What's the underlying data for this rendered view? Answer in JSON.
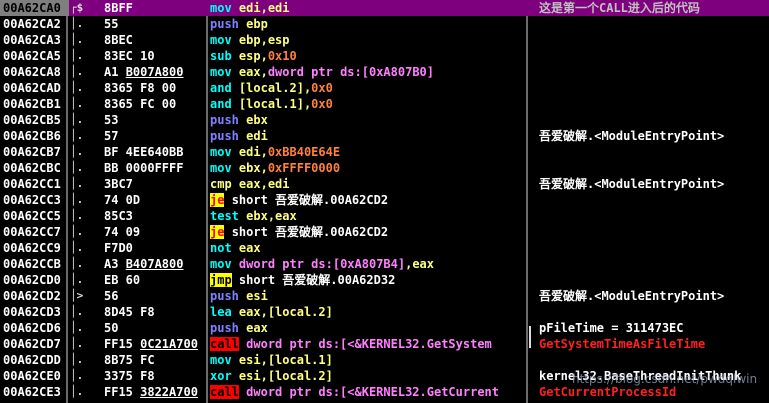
{
  "comment_banner": "这是第一个CALL进入后的代码",
  "watermark": "https://blog.csdn.net/pwdqlwin",
  "rows": [
    {
      "addr": "00A62CA0",
      "gut": "┌$",
      "hex": "8BFF",
      "mn": "mov",
      "mc": "plain",
      "args": [
        {
          "t": "edi,edi",
          "c": "reg"
        }
      ],
      "cmt": [
        {
          "t": "这是第一个CALL进入后的代码",
          "c": "gray"
        }
      ],
      "sel": true
    },
    {
      "addr": "00A62CA2",
      "gut": "│.",
      "hex": "55",
      "mn": "push",
      "mc": "push",
      "args": [
        {
          "t": "ebp",
          "c": "reg"
        }
      ],
      "cmt": []
    },
    {
      "addr": "00A62CA3",
      "gut": "│.",
      "hex": "8BEC",
      "mn": "mov",
      "mc": "plain",
      "args": [
        {
          "t": "ebp,esp",
          "c": "reg"
        }
      ],
      "cmt": []
    },
    {
      "addr": "00A62CA5",
      "gut": "│.",
      "hex": "83EC 10",
      "mn": "sub",
      "mc": "plain",
      "args": [
        {
          "t": "esp,",
          "c": "reg"
        },
        {
          "t": "0x10",
          "c": "num"
        }
      ],
      "cmt": []
    },
    {
      "addr": "00A62CA8",
      "gut": "│.",
      "hex": "A1 ",
      "hexu": "B007A800",
      "mn": "mov",
      "mc": "plain",
      "args": [
        {
          "t": "eax,",
          "c": "reg"
        },
        {
          "t": "dword ptr ds:[0xA807B0]",
          "c": "mem"
        }
      ],
      "cmt": []
    },
    {
      "addr": "00A62CAD",
      "gut": "│.",
      "hex": "8365 F8 00",
      "mn": "and",
      "mc": "plain",
      "args": [
        {
          "t": "[local.2],",
          "c": "reg"
        },
        {
          "t": "0x0",
          "c": "num"
        }
      ],
      "cmt": []
    },
    {
      "addr": "00A62CB1",
      "gut": "│.",
      "hex": "8365 FC 00",
      "mn": "and",
      "mc": "plain",
      "args": [
        {
          "t": "[local.1],",
          "c": "reg"
        },
        {
          "t": "0x0",
          "c": "num"
        }
      ],
      "cmt": []
    },
    {
      "addr": "00A62CB5",
      "gut": "│.",
      "hex": "53",
      "mn": "push",
      "mc": "push",
      "args": [
        {
          "t": "ebx",
          "c": "reg"
        }
      ],
      "cmt": []
    },
    {
      "addr": "00A62CB6",
      "gut": "│.",
      "hex": "57",
      "mn": "push",
      "mc": "push",
      "args": [
        {
          "t": "edi",
          "c": "reg"
        }
      ],
      "cmt": [
        {
          "t": "吾爱破解.<ModuleEntryPoint>",
          "c": "w"
        }
      ]
    },
    {
      "addr": "00A62CB7",
      "gut": "│.",
      "hex": "BF 4EE640BB",
      "mn": "mov",
      "mc": "plain",
      "args": [
        {
          "t": "edi,",
          "c": "reg"
        },
        {
          "t": "0xBB40E64E",
          "c": "num"
        }
      ],
      "cmt": []
    },
    {
      "addr": "00A62CBC",
      "gut": "│.",
      "hex": "BB 0000FFFF",
      "mn": "mov",
      "mc": "plain",
      "args": [
        {
          "t": "ebx,",
          "c": "reg"
        },
        {
          "t": "0xFFFF0000",
          "c": "num"
        }
      ],
      "cmt": []
    },
    {
      "addr": "00A62CC1",
      "gut": "│.",
      "hex": "3BC7",
      "mn": "cmp",
      "mc": "cmp",
      "args": [
        {
          "t": "eax,edi",
          "c": "reg"
        }
      ],
      "cmt": [
        {
          "t": "吾爱破解.<ModuleEntryPoint>",
          "c": "w"
        }
      ]
    },
    {
      "addr": "00A62CC3",
      "gut": "│.",
      "hex": "74 0D",
      "mn": "je",
      "mc": "je",
      "args": [
        {
          "t": "short 吾爱破解.00A62CD2",
          "c": "txt"
        }
      ],
      "cmt": []
    },
    {
      "addr": "00A62CC5",
      "gut": "│.",
      "hex": "85C3",
      "mn": "test",
      "mc": "plain",
      "args": [
        {
          "t": "ebx,eax",
          "c": "reg"
        }
      ],
      "cmt": []
    },
    {
      "addr": "00A62CC7",
      "gut": "│.",
      "hex": "74 09",
      "mn": "je",
      "mc": "je",
      "args": [
        {
          "t": "short 吾爱破解.00A62CD2",
          "c": "txt"
        }
      ],
      "cmt": []
    },
    {
      "addr": "00A62CC9",
      "gut": "│.",
      "hex": "F7D0",
      "mn": "not",
      "mc": "plain",
      "args": [
        {
          "t": "eax",
          "c": "reg"
        }
      ],
      "cmt": []
    },
    {
      "addr": "00A62CCB",
      "gut": "│.",
      "hex": "A3 ",
      "hexu": "B407A800",
      "mn": "mov",
      "mc": "plain",
      "args": [
        {
          "t": "dword ptr ds:[0xA807B4]",
          "c": "mem"
        },
        {
          "t": ",eax",
          "c": "reg"
        }
      ],
      "cmt": []
    },
    {
      "addr": "00A62CD0",
      "gut": "│.",
      "hex": "EB 60",
      "mn": "jmp",
      "mc": "jmp",
      "args": [
        {
          "t": "short 吾爱破解.00A62D32",
          "c": "txt"
        }
      ],
      "cmt": []
    },
    {
      "addr": "00A62CD2",
      "gut": "│>",
      "hex": "56",
      "mn": "push",
      "mc": "push",
      "args": [
        {
          "t": "esi",
          "c": "reg"
        }
      ],
      "cmt": [
        {
          "t": "吾爱破解.<ModuleEntryPoint>",
          "c": "w"
        }
      ]
    },
    {
      "addr": "00A62CD3",
      "gut": "│.",
      "hex": "8D45 F8",
      "mn": "lea",
      "mc": "plain",
      "args": [
        {
          "t": "eax,[local.2]",
          "c": "reg"
        }
      ],
      "cmt": []
    },
    {
      "addr": "00A62CD6",
      "gut": "│.",
      "hex": "50",
      "mn": "push",
      "mc": "push",
      "args": [
        {
          "t": "eax",
          "c": "reg"
        }
      ],
      "cmt": [
        {
          "t": "pFileTime = 311473EC",
          "c": "w"
        }
      ]
    },
    {
      "addr": "00A62CD7",
      "gut": "│.",
      "hex": "FF15 ",
      "hexu": "0C21A700",
      "mn": "call",
      "mc": "call",
      "args": [
        {
          "t": "dword ptr ds:[<&KERNEL32.GetSystem",
          "c": "sym"
        }
      ],
      "cmt": [
        {
          "t": "GetSystemTimeAsFileTime",
          "c": "red"
        }
      ]
    },
    {
      "addr": "00A62CDD",
      "gut": "│.",
      "hex": "8B75 FC",
      "mn": "mov",
      "mc": "plain",
      "args": [
        {
          "t": "esi,[local.1]",
          "c": "reg"
        }
      ],
      "cmt": []
    },
    {
      "addr": "00A62CE0",
      "gut": "│.",
      "hex": "3375 F8",
      "mn": "xor",
      "mc": "plain",
      "args": [
        {
          "t": "esi,[local.2]",
          "c": "reg"
        }
      ],
      "cmt": [
        {
          "t": "kernel32.BaseThreadInitThunk",
          "c": "w"
        }
      ]
    },
    {
      "addr": "00A62CE3",
      "gut": "│.",
      "hex": "FF15 ",
      "hexu": "3822A700",
      "mn": "call",
      "mc": "call",
      "args": [
        {
          "t": "dword ptr ds:[<&KERNEL32.GetCurrent",
          "c": "sym"
        }
      ],
      "cmt": [
        {
          "t": "GetCurrentProcessId",
          "c": "red"
        }
      ]
    }
  ]
}
